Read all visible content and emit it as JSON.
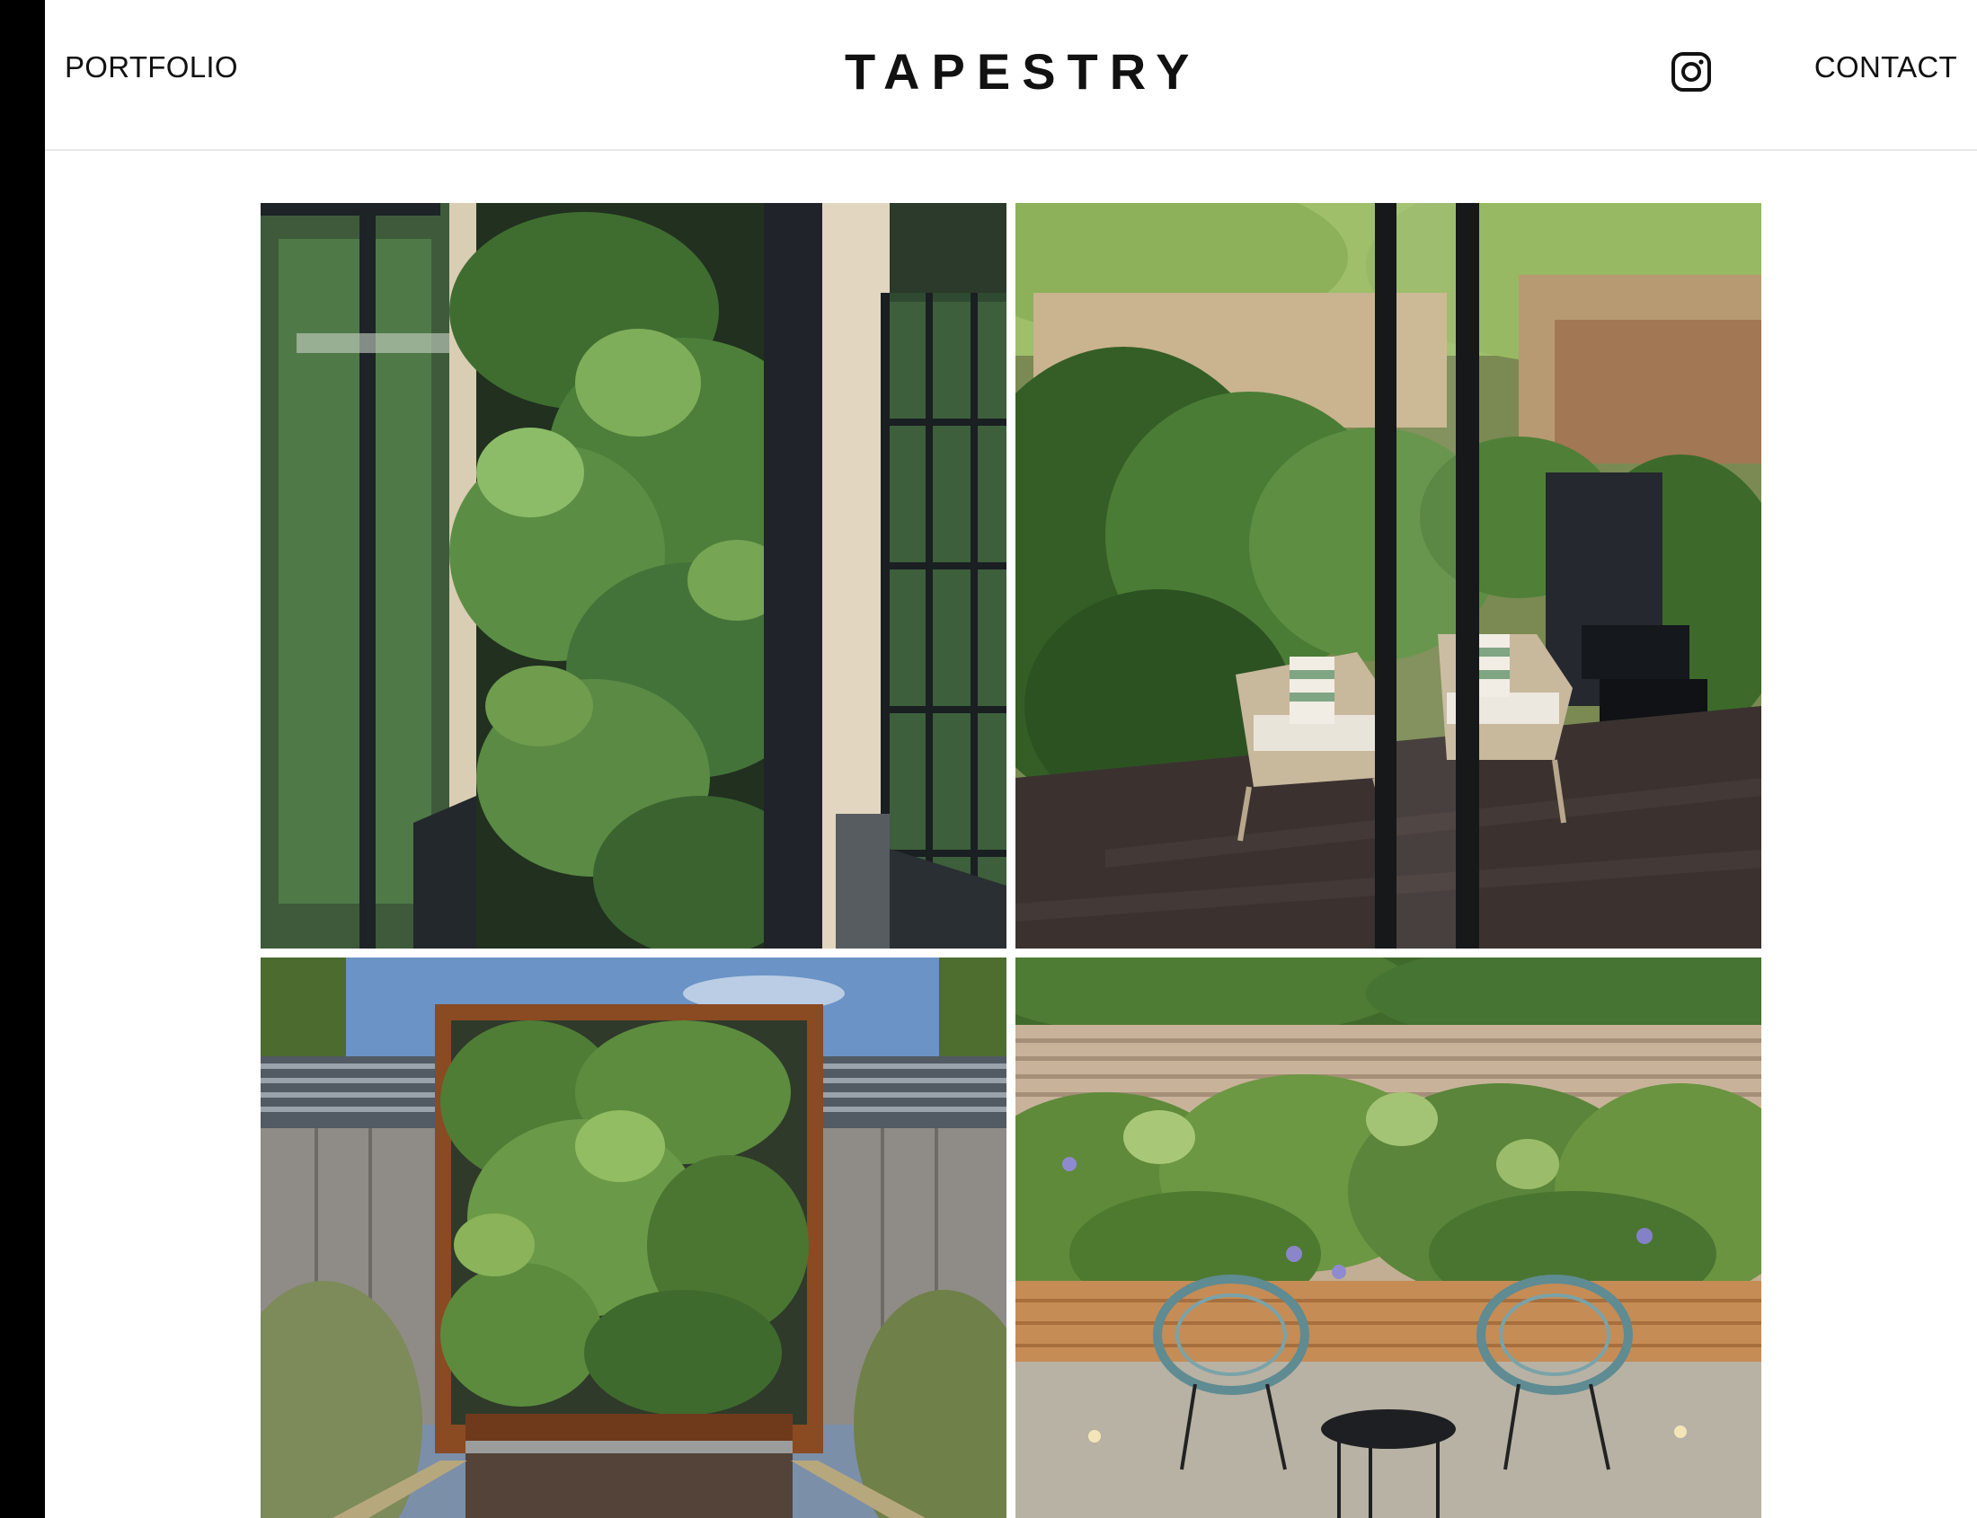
{
  "header": {
    "logo": "TAPESTRY",
    "nav_left": "PORTFOLIO",
    "nav_right": "CONTACT",
    "social_icon": "instagram-icon"
  },
  "gallery": {
    "photos": [
      {
        "subject": "green-wall-between-windows-photo"
      },
      {
        "subject": "courtyard-garden-with-chairs-photo"
      },
      {
        "subject": "corten-steel-living-wall-water-feature-photo"
      },
      {
        "subject": "garden-wall-with-wire-chairs-photo"
      }
    ]
  },
  "colors": {
    "sidebar": "#000000",
    "text": "#111111",
    "divider": "#e9e9e9"
  }
}
